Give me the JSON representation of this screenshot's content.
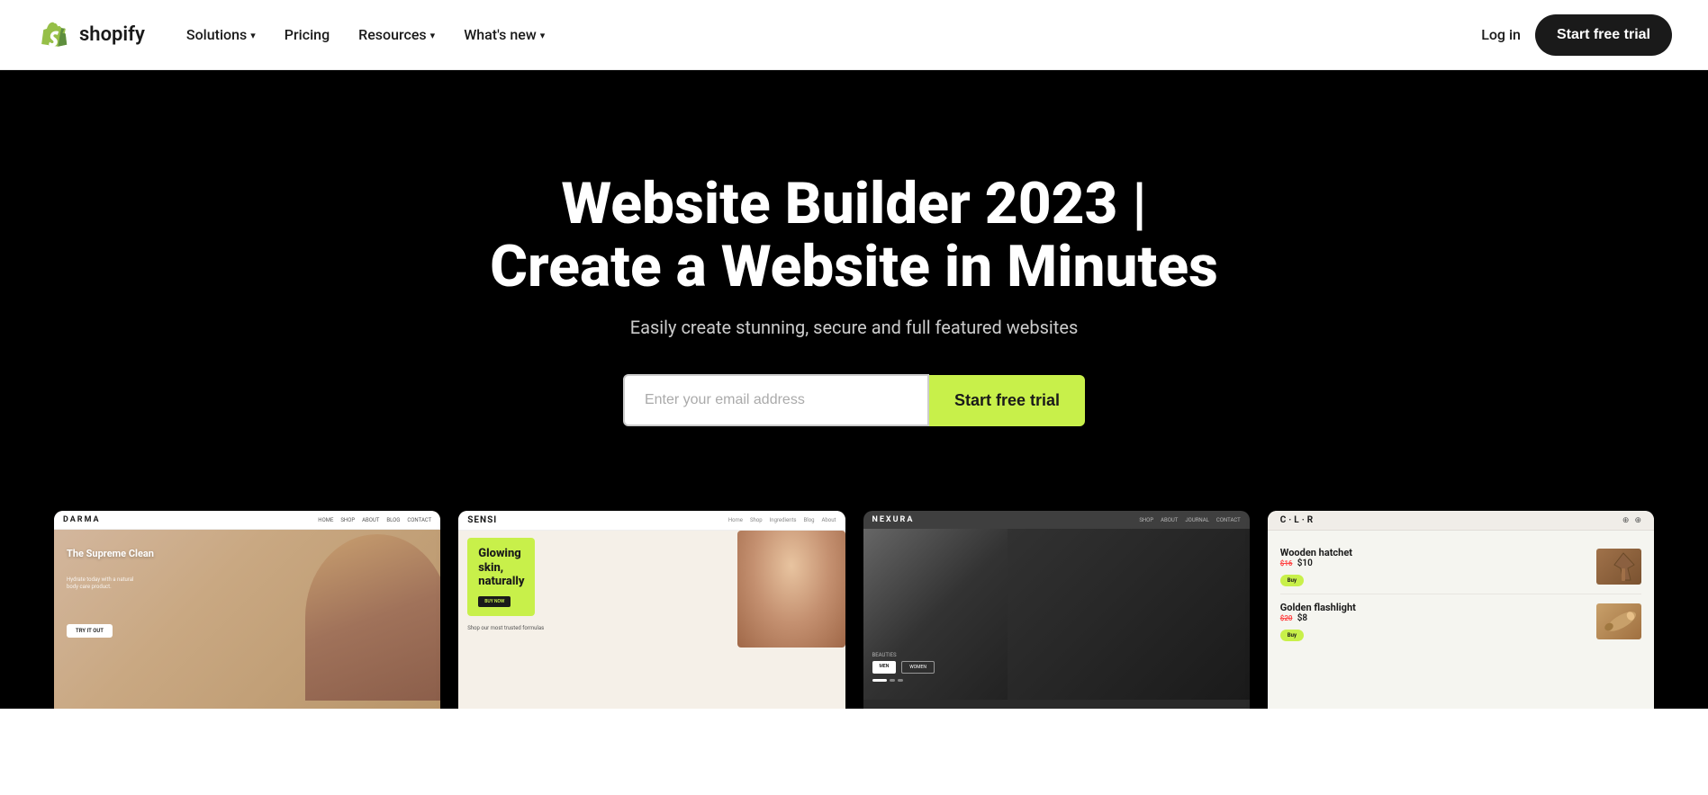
{
  "navbar": {
    "logo_text": "shopify",
    "nav_items": [
      {
        "label": "Solutions",
        "has_dropdown": true
      },
      {
        "label": "Pricing",
        "has_dropdown": false
      },
      {
        "label": "Resources",
        "has_dropdown": true
      },
      {
        "label": "What's new",
        "has_dropdown": true
      }
    ],
    "login_label": "Log in",
    "cta_label": "Start free trial"
  },
  "hero": {
    "title_line1": "Website Builder 2023 |",
    "title_line2": "Create a Website in Minutes",
    "subtitle": "Easily create stunning, secure and full featured websites",
    "email_placeholder": "Enter your email address",
    "cta_label": "Start free trial"
  },
  "store_cards": [
    {
      "id": "darma",
      "brand": "DARMA",
      "nav_items": [
        "Home",
        "Shop",
        "About",
        "Blog",
        "Contact"
      ],
      "headline": "The Supreme Clean",
      "subtext": "Hydrate today with a\nnatural body care\nproduct.",
      "btn_label": "TRY IT OUT"
    },
    {
      "id": "sensi",
      "brand": "SENSI",
      "nav_items": [
        "Home",
        "Shop",
        "Ingredients",
        "Blog",
        "About"
      ],
      "green_text_line1": "Glowing",
      "green_text_line2": "skin,",
      "green_text_line3": "naturally",
      "btn_label": "BUY NOW",
      "bottom_text": "Shop our most trusted formulas"
    },
    {
      "id": "nexura",
      "brand": "NEXURA",
      "nav_items": [
        "Shop",
        "About",
        "Journal",
        "Contact"
      ],
      "category": "BEAUTIES",
      "btn_men": "MEN",
      "btn_women": "WOMEN"
    },
    {
      "id": "clr",
      "brand": "C·L·R",
      "item1_name": "Wooden hatchet",
      "item1_old_price": "$16",
      "item1_price": "$10",
      "item2_name": "Golden flashlight",
      "item2_old_price": "$20",
      "item2_price": "$8",
      "buy_label": "Buy"
    }
  ],
  "icons": {
    "chevron": "▾",
    "bag": "🛍",
    "search": "🔍",
    "cart": "🛒"
  }
}
